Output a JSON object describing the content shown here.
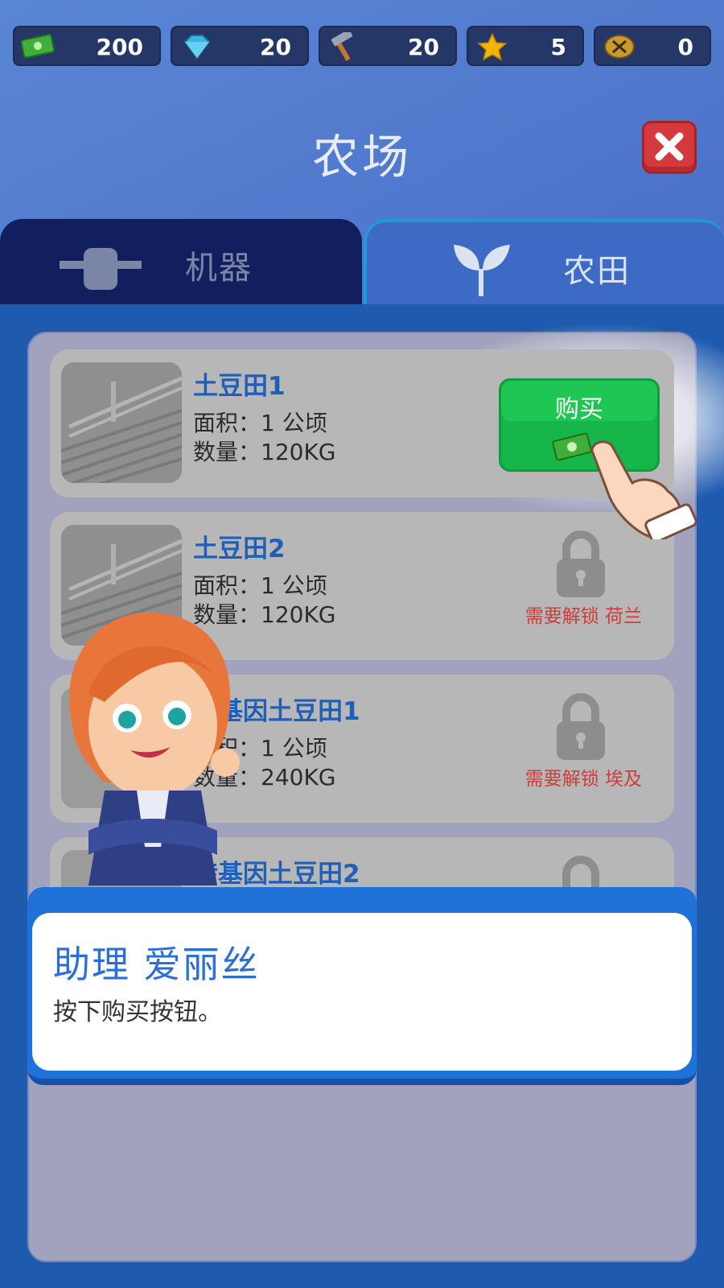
{
  "currencies": [
    {
      "icon": "cash-icon",
      "value": "200"
    },
    {
      "icon": "diamond-icon",
      "value": "20"
    },
    {
      "icon": "hammer-icon",
      "value": "20"
    },
    {
      "icon": "star-icon",
      "value": "5"
    },
    {
      "icon": "tools-badge-icon",
      "value": "0"
    }
  ],
  "title": "农场",
  "tabs": {
    "machine": {
      "label": "机器",
      "icon": "wrench-glove-icon"
    },
    "field": {
      "label": "农田",
      "icon": "sprout-icon"
    }
  },
  "fields": [
    {
      "name": "土豆田1",
      "area": "面积：1 公顷",
      "quantity": "数量：120KG",
      "status": "buy",
      "buy_label": "购买"
    },
    {
      "name": "土豆田2",
      "area": "面积：1 公顷",
      "quantity": "数量：120KG",
      "status": "locked",
      "unlock_text": "需要解锁 荷兰"
    },
    {
      "name": "转基因土豆田1",
      "area": "面积：1 公顷",
      "quantity": "数量：240KG",
      "status": "locked",
      "unlock_text": "需要解锁 埃及"
    },
    {
      "name": "转基因土豆田2",
      "status": "locked"
    }
  ],
  "dialog": {
    "speaker": "助理 爱丽丝",
    "message": "按下购买按钮。"
  },
  "colors": {
    "accent_blue": "#1f72d8",
    "buy_green": "#1ec653",
    "lock_red": "#d33a3a",
    "close_red": "#d6393d"
  }
}
